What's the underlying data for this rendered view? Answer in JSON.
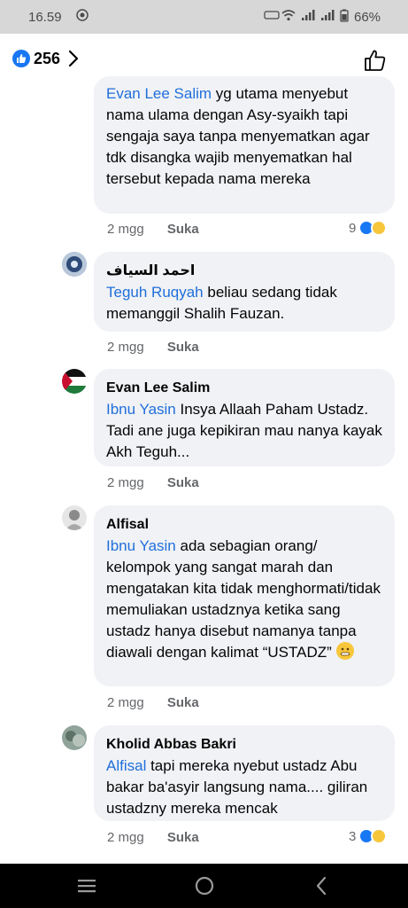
{
  "status_bar": {
    "time": "16.59",
    "battery": "66%"
  },
  "header": {
    "like_count": "256"
  },
  "comments": [
    {
      "author": "",
      "mention": "Evan Lee Salim",
      "text": " yg utama menyebut nama ulama dengan Asy-syaikh tapi sengaja saya tanpa menyematkan agar tdk disangka wajib menyematkan hal tersebut kepada nama mereka",
      "time": "2 mgg",
      "like_label": "Suka",
      "reaction_count": "9"
    },
    {
      "author": "احمد السياف",
      "mention": "Teguh Ruqyah",
      "text": " beliau sedang tidak memanggil Shalih Fauzan.",
      "time": "2 mgg",
      "like_label": "Suka"
    },
    {
      "author": "Evan Lee Salim",
      "mention": "Ibnu Yasin",
      "text": " Insya Allaah Paham Ustadz. Tadi ane juga kepikiran mau nanya kayak Akh Teguh...",
      "time": "2 mgg",
      "like_label": "Suka"
    },
    {
      "author": "Alfisal",
      "mention": "Ibnu Yasin",
      "text": " ada sebagian orang/ kelompok yang sangat marah dan mengatakan kita tidak menghormati/tidak memuliakan ustadznya ketika sang ustadz hanya disebut namanya tanpa diawali dengan kalimat “USTADZ” ",
      "time": "2 mgg",
      "like_label": "Suka"
    },
    {
      "author": "Kholid Abbas Bakri",
      "mention": "Alfisal",
      "text": " tapi mereka nyebut ustadz Abu bakar ba'asyir langsung nama.... giliran ustadzny mereka mencak",
      "time": "2 mgg",
      "like_label": "Suka",
      "reaction_count": "3"
    }
  ],
  "colors": {
    "mention": "#216fdb",
    "bubble": "#f0f2f5",
    "brand": "#1877f2",
    "meta": "#65676b"
  },
  "icons": [
    "wifi-icon",
    "signal-icon",
    "battery-icon",
    "like-reaction-icon",
    "haha-reaction-icon",
    "thumbs-up-icon",
    "chevron-right-icon",
    "menu-icon",
    "home-circle-icon",
    "back-icon"
  ]
}
